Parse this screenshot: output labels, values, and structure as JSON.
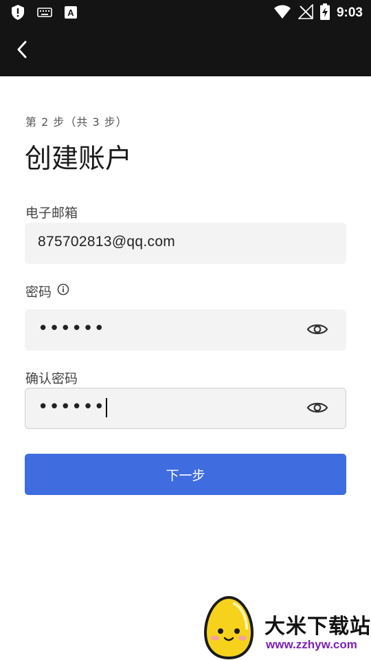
{
  "status_bar": {
    "time": "9:03",
    "left_icons": [
      "shield-icon",
      "keyboard-icon",
      "a-box-icon"
    ],
    "right_icons": [
      "wifi-icon",
      "no-signal-icon",
      "battery-charging-icon"
    ]
  },
  "app_bar": {
    "back_icon": "chevron-left-icon"
  },
  "step": "第 2 步（共 3 步）",
  "title": "创建账户",
  "email": {
    "label": "电子邮箱",
    "value": "875702813@qq.com"
  },
  "password": {
    "label": "密码",
    "value": "••••••",
    "info_icon": "info-circle-icon",
    "toggle_icon": "eye-icon"
  },
  "confirm_password": {
    "label": "确认密码",
    "value": "••••••",
    "toggle_icon": "eye-icon"
  },
  "next_button": {
    "label": "下一步"
  },
  "watermark": {
    "title": "大米下载站",
    "url": "www.zzhyw.com"
  },
  "colors": {
    "app_bar": "#141414",
    "primary_button": "#3f6de0",
    "input_bg": "#f3f3f3"
  }
}
